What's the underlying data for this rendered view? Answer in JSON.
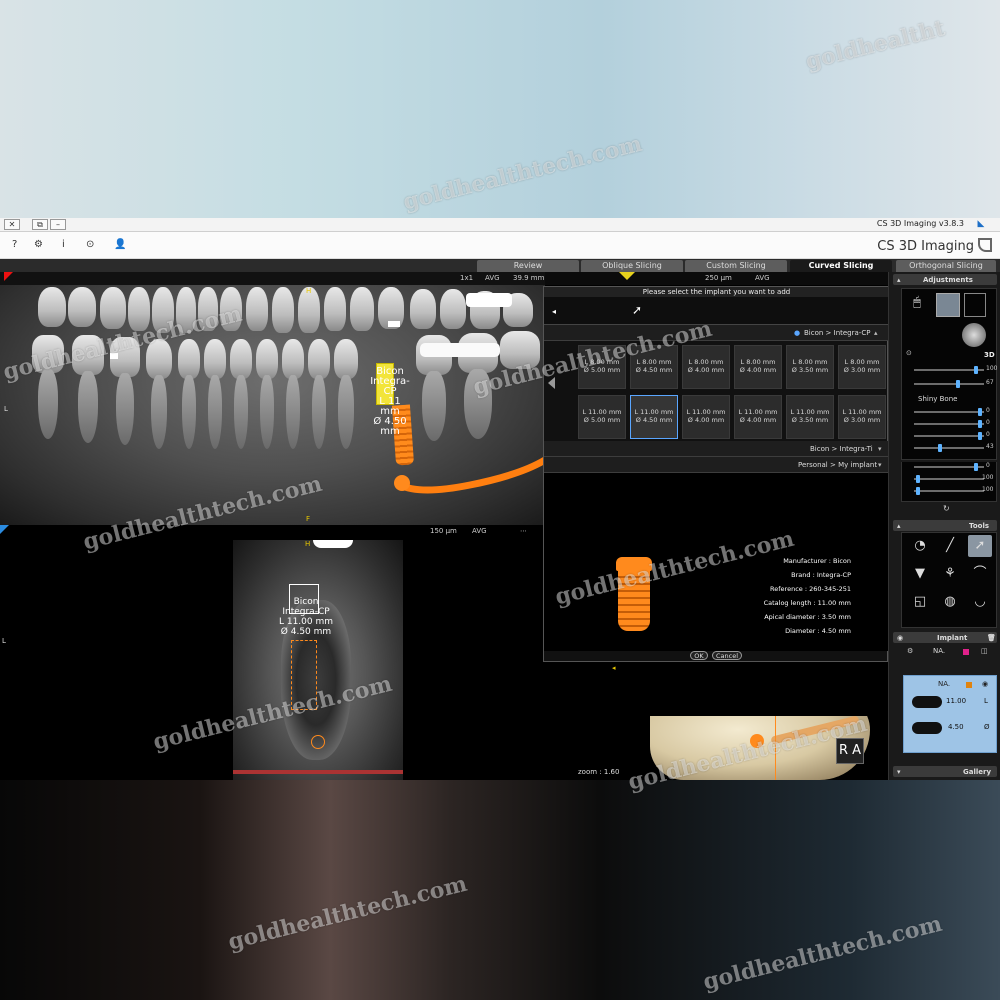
{
  "window": {
    "title": "CS 3D Imaging v3.8.3",
    "brand": "CS 3D Imaging"
  },
  "toolbar": {
    "help": "?",
    "settings": "⚙",
    "info": "i",
    "clock": "⊙",
    "user": "👤"
  },
  "tabs": [
    {
      "label": "Orthogonal Slicing",
      "active": false
    },
    {
      "label": "Curved Slicing",
      "active": true
    },
    {
      "label": "Custom Slicing",
      "active": false
    },
    {
      "label": "Oblique Slicing",
      "active": false
    },
    {
      "label": "Review",
      "active": false
    }
  ],
  "pano_view": {
    "thickness": "39.9 mm",
    "mode": "AVG",
    "zoom": "1x1",
    "pixel": "250 µm",
    "mode2": "AVG",
    "implant_label": [
      "Bicon",
      "Integra-CP",
      "L 11 mm",
      "Ø 4.50 mm"
    ]
  },
  "section_view": {
    "pixel": "150 µm",
    "mode": "AVG",
    "implant_label": [
      "Bicon",
      "Integra-CP",
      "L 11.00 mm",
      "Ø 4.50 mm"
    ]
  },
  "render_view": {
    "orientation": "R A",
    "zoom": "zoom : 1.60"
  },
  "dialog": {
    "title": "Please select the implant you want to add",
    "group1": "Bicon > Integra-CP",
    "group2": "Bicon > Integra-Ti",
    "group3": "Personal > My implant",
    "row1": [
      {
        "l": "L 8.00 mm",
        "d": "Ø 3.00 mm"
      },
      {
        "l": "L 8.00 mm",
        "d": "Ø 3.50 mm"
      },
      {
        "l": "L 8.00 mm",
        "d": "Ø 4.00 mm"
      },
      {
        "l": "L 8.00 mm",
        "d": "Ø 4.00 mm"
      },
      {
        "l": "L 8.00 mm",
        "d": "Ø 4.50 mm"
      },
      {
        "l": "L 8.00 mm",
        "d": "Ø 5.00 mm"
      }
    ],
    "row2": [
      {
        "l": "L 11.00 mm",
        "d": "Ø 3.00 mm"
      },
      {
        "l": "L 11.00 mm",
        "d": "Ø 3.50 mm"
      },
      {
        "l": "L 11.00 mm",
        "d": "Ø 4.00 mm"
      },
      {
        "l": "L 11.00 mm",
        "d": "Ø 4.00 mm"
      },
      {
        "l": "L 11.00 mm",
        "d": "Ø 4.50 mm"
      },
      {
        "l": "L 11.00 mm",
        "d": "Ø 5.00 mm"
      }
    ],
    "specs": [
      "Manufacturer : Bicon",
      "Brand : Integra-CP",
      "Reference : 260-345-251",
      "Catalog length : 11.00 mm",
      "Apical diameter : 3.50 mm",
      "Diameter : 4.50 mm"
    ],
    "ok": "OK",
    "cancel": "Cancel"
  },
  "sidebar": {
    "adjustments": "Adjustments",
    "three_d": "3D",
    "preset": "Shiny Bone",
    "values": [
      "100",
      "67",
      "0",
      "0",
      "0",
      "43",
      "0",
      "100",
      "100"
    ],
    "tools": "Tools",
    "implant": "Implant",
    "implant_name": "NA.",
    "length": "11.00",
    "diameter": "4.50",
    "gallery": "Gallery"
  },
  "watermark": [
    "goldhealthtech.com",
    "goldhealtht"
  ]
}
